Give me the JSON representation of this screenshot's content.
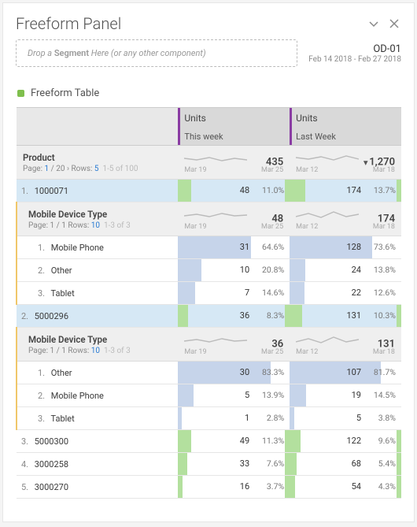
{
  "panel": {
    "title": "Freeform Panel",
    "dropzone_prefix": "Drop a ",
    "dropzone_bold": "Segment",
    "dropzone_suffix": " Here (or any other component)",
    "project": "OD-01",
    "date_range": "Feb 14 2018 - Feb 27 2018",
    "table_title": "Freeform Table"
  },
  "columns": [
    {
      "title": "Units",
      "sub": "This week",
      "d_from": "Mar 19",
      "d_to": "Mar 25"
    },
    {
      "title": "Units",
      "sub": "Last Week",
      "d_from": "Mar 12",
      "d_to": "Mar 18"
    }
  ],
  "dim": {
    "name": "Product",
    "page_label": "Page:",
    "page_cur": "1",
    "page_total": "20",
    "rows_label": "Rows:",
    "rows": "5",
    "range": "1-5 of 100",
    "total_tw": "435",
    "total_lw": "1,270",
    "lw_arrow": true
  },
  "rows": [
    {
      "n": "1.",
      "label": "1000071",
      "tw_v": "48",
      "tw_p": "11.0%",
      "tw_bar": 12,
      "lw_v": "174",
      "lw_p": "13.7%",
      "lw_bar": 14,
      "selected": true,
      "breakdown": {
        "name": "Mobile Device Type",
        "page": "Page: 1 / 1 Rows:",
        "rows": "10",
        "range": "1-3 of 3",
        "tw_total": "48",
        "lw_total": "174",
        "items": [
          {
            "n": "1.",
            "label": "Mobile Phone",
            "tw_v": "31",
            "tw_p": "64.6%",
            "tw_bar": 65,
            "lw_v": "128",
            "lw_p": "73.6%",
            "lw_bar": 74
          },
          {
            "n": "2.",
            "label": "Other",
            "tw_v": "10",
            "tw_p": "20.8%",
            "tw_bar": 21,
            "lw_v": "24",
            "lw_p": "13.8%",
            "lw_bar": 14
          },
          {
            "n": "3.",
            "label": "Tablet",
            "tw_v": "7",
            "tw_p": "14.6%",
            "tw_bar": 15,
            "lw_v": "22",
            "lw_p": "12.6%",
            "lw_bar": 13
          }
        ]
      }
    },
    {
      "n": "2.",
      "label": "5000296",
      "tw_v": "36",
      "tw_p": "8.3%",
      "tw_bar": 9,
      "lw_v": "131",
      "lw_p": "10.3%",
      "lw_bar": 11,
      "selected": true,
      "breakdown": {
        "name": "Mobile Device Type",
        "page": "Page: 1 / 1 Rows:",
        "rows": "10",
        "range": "1-3 of 3",
        "tw_total": "36",
        "lw_total": "131",
        "items": [
          {
            "n": "1.",
            "label": "Other",
            "tw_v": "30",
            "tw_p": "83.3%",
            "tw_bar": 83,
            "lw_v": "107",
            "lw_p": "81.7%",
            "lw_bar": 82
          },
          {
            "n": "2.",
            "label": "Mobile Phone",
            "tw_v": "5",
            "tw_p": "13.9%",
            "tw_bar": 14,
            "lw_v": "19",
            "lw_p": "14.5%",
            "lw_bar": 15
          },
          {
            "n": "3.",
            "label": "Tablet",
            "tw_v": "1",
            "tw_p": "2.8%",
            "tw_bar": 3,
            "lw_v": "5",
            "lw_p": "3.8%",
            "lw_bar": 4
          }
        ]
      }
    },
    {
      "n": "3.",
      "label": "5000300",
      "tw_v": "49",
      "tw_p": "11.3%",
      "tw_bar": 12,
      "lw_v": "122",
      "lw_p": "9.6%",
      "lw_bar": 10
    },
    {
      "n": "4.",
      "label": "3000258",
      "tw_v": "33",
      "tw_p": "7.6%",
      "tw_bar": 8,
      "lw_v": "68",
      "lw_p": "5.4%",
      "lw_bar": 6
    },
    {
      "n": "5.",
      "label": "3000270",
      "tw_v": "16",
      "tw_p": "3.7%",
      "tw_bar": 4,
      "lw_v": "54",
      "lw_p": "4.3%",
      "lw_bar": 5
    }
  ]
}
